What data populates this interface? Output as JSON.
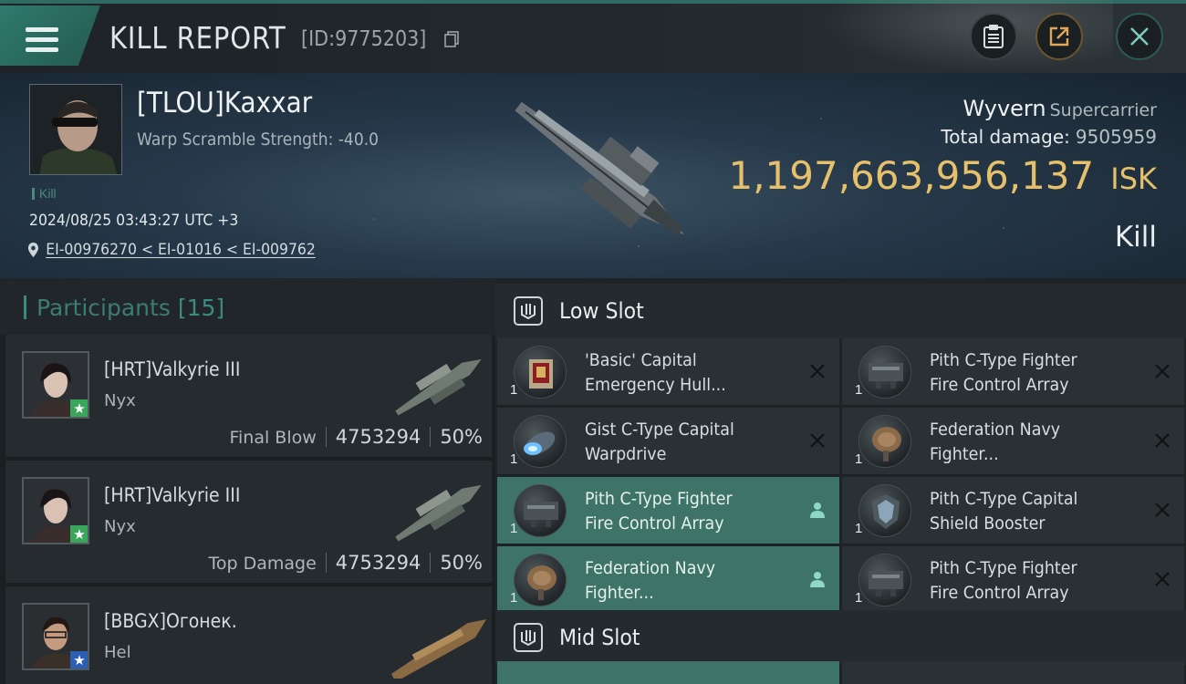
{
  "header": {
    "title": "KILL REPORT",
    "report_id": "[ID:9775203]",
    "buttons": {
      "clipboard": "clipboard-icon",
      "share": "share-icon",
      "close": "close-icon"
    }
  },
  "victim": {
    "name": "[TLOU]Kaxxar",
    "warp_scramble": "Warp Scramble Strength: -40.0",
    "tag": "Kill",
    "timestamp": "2024/08/25 03:43:27 UTC +3",
    "location": "EI-00976270 < EI-01016 < EI-009762",
    "ship_name": "Wyvern",
    "ship_class": "Supercarrier",
    "total_damage_label": "Total damage:",
    "total_damage": "9505959",
    "isk_value": "1,197,663,956,137",
    "isk_unit": "ISK",
    "result": "Kill"
  },
  "participants": {
    "title": "Participants",
    "count": "[15]",
    "rows": [
      {
        "name": "[HRT]Valkyrie III",
        "ship": "Nyx",
        "label": "Final Blow",
        "damage": "4753294",
        "percent": "50%",
        "badge": "star-green"
      },
      {
        "name": "[HRT]Valkyrie III",
        "ship": "Nyx",
        "label": "Top Damage",
        "damage": "4753294",
        "percent": "50%",
        "badge": "star-green"
      },
      {
        "name": "[BBGX]Oгонек.",
        "ship": "Hel",
        "label": "",
        "damage": "",
        "percent": "",
        "badge": "star-blue"
      }
    ]
  },
  "slots": {
    "low_slot_title": "Low Slot",
    "mid_slot_title": "Mid Slot",
    "low_slot_modules": [
      {
        "line1": "'Basic' Capital",
        "line2": "Emergency Hull...",
        "qty": "1",
        "status": "destroyed"
      },
      {
        "line1": "Pith C-Type Fighter",
        "line2": "Fire Control Array",
        "qty": "1",
        "status": "destroyed"
      },
      {
        "line1": "Gist C-Type Capital",
        "line2": "Warpdrive",
        "qty": "1",
        "status": "destroyed"
      },
      {
        "line1": "Federation Navy",
        "line2": "Fighter...",
        "qty": "1",
        "status": "destroyed"
      },
      {
        "line1": "Pith C-Type Fighter",
        "line2": "Fire Control Array",
        "qty": "1",
        "status": "dropped"
      },
      {
        "line1": "Pith C-Type Capital",
        "line2": "Shield Booster",
        "qty": "1",
        "status": "destroyed"
      },
      {
        "line1": "Federation Navy",
        "line2": "Fighter...",
        "qty": "1",
        "status": "dropped"
      },
      {
        "line1": "Pith C-Type Fighter",
        "line2": "Fire Control Array",
        "qty": "1",
        "status": "destroyed"
      }
    ]
  },
  "colors": {
    "accent_teal": "#3e7468",
    "isk_gold": "#e6c06a",
    "header_tab": "#2f7a6e"
  }
}
